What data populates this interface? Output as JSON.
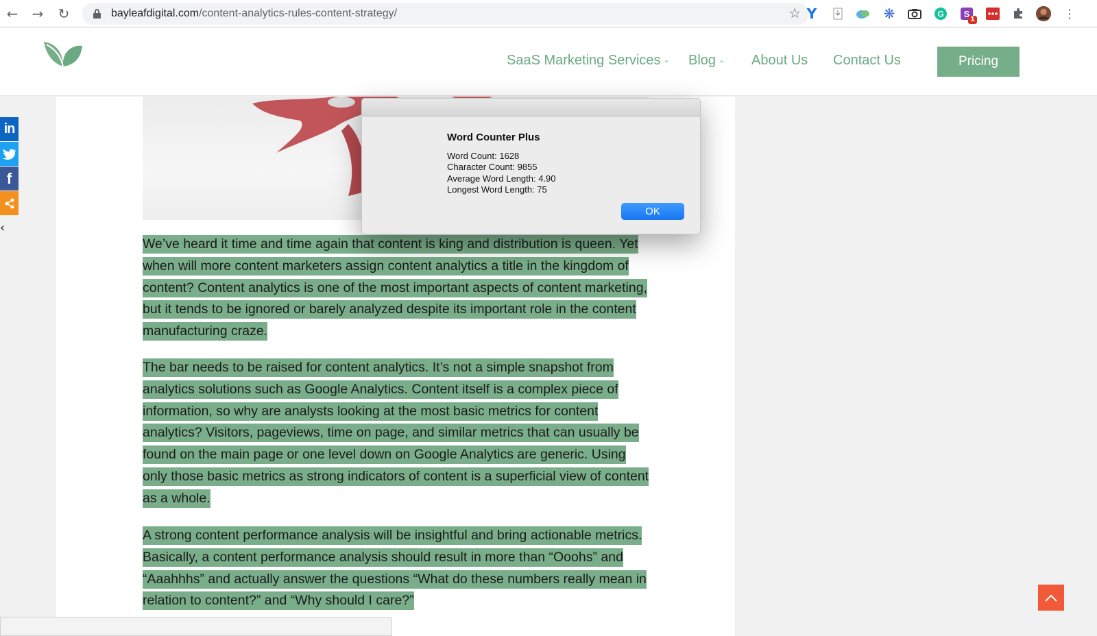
{
  "browser": {
    "url_domain": "bayleafdigital.com",
    "url_path": "/content-analytics-rules-content-strategy/",
    "extension_badge": "1"
  },
  "header": {
    "nav": [
      {
        "label": "SaaS Marketing Services",
        "has_dropdown": true
      },
      {
        "label": "Blog",
        "has_dropdown": true
      },
      {
        "label": "About Us",
        "has_dropdown": false
      },
      {
        "label": "Contact Us",
        "has_dropdown": false
      }
    ],
    "pricing_label": "Pricing",
    "accent": "#6aa982",
    "button_color": "#77ae8a"
  },
  "article": {
    "highlight_color": "#7aae8a",
    "paragraphs": [
      "We’ve heard it time and time again that content is king and distribution is queen. Yet when will more content marketers assign content analytics a title in the kingdom of content? Content analytics is one of the most important aspects of content marketing, but it tends to be ignored or barely analyzed despite its important role in the content manufacturing craze.",
      "The bar needs to be raised for content analytics. It’s not a simple snapshot from analytics solutions such as Google Analytics. Content itself is a complex piece of information, so why are analysts looking at the most basic metrics for content analytics? Visitors, pageviews, time on page, and similar metrics that can usually be found on the main page or one level down on Google Analytics are generic. Using only those basic metrics as strong indicators of content is a superficial view of content as a whole.",
      "A strong content performance analysis will be insightful and bring actionable metrics. Basically, a content performance analysis should result in more than “Ooohs” and “Aaahhhs” and actually answer the questions “What do these numbers really mean in relation to content?” and “Why should I care?”"
    ]
  },
  "social": [
    {
      "name": "linkedin",
      "glyph": "in",
      "color": "#0a66c2"
    },
    {
      "name": "twitter",
      "glyph": "t",
      "color": "#1da1f2"
    },
    {
      "name": "facebook",
      "glyph": "f",
      "color": "#3b5998"
    },
    {
      "name": "share",
      "glyph": "<",
      "color": "#f4901e"
    }
  ],
  "dialog": {
    "title": "Word Counter Plus",
    "lines": [
      "Word Count: 1628",
      "Character Count: 9855",
      "Average Word Length: 4.90",
      "Longest Word Length: 75"
    ],
    "ok_label": "OK"
  }
}
